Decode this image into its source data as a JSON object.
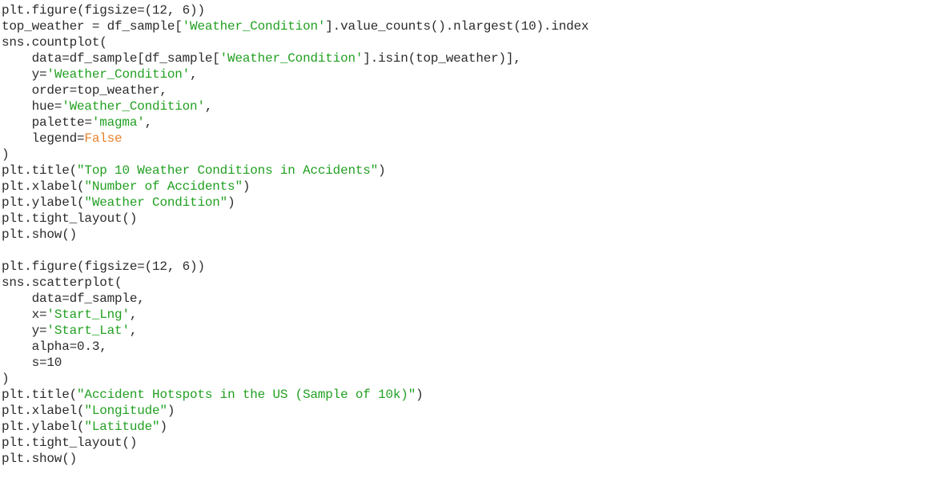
{
  "colors": {
    "background": "#ffffff",
    "default_text": "#2b2b2b",
    "string": "#22a022",
    "keyword": "#e8822a"
  },
  "code": {
    "lines": [
      [
        {
          "t": "plt.figure(figsize=(12, 6))",
          "k": "plain"
        }
      ],
      [
        {
          "t": "top_weather = df_sample[",
          "k": "plain"
        },
        {
          "t": "'Weather_Condition'",
          "k": "str"
        },
        {
          "t": "].value_counts().nlargest(10).index",
          "k": "plain"
        }
      ],
      [
        {
          "t": "sns.countplot(",
          "k": "plain"
        }
      ],
      [
        {
          "t": "    data=df_sample[df_sample[",
          "k": "plain"
        },
        {
          "t": "'Weather_Condition'",
          "k": "str"
        },
        {
          "t": "].isin(top_weather)],",
          "k": "plain"
        }
      ],
      [
        {
          "t": "    y=",
          "k": "plain"
        },
        {
          "t": "'Weather_Condition'",
          "k": "str"
        },
        {
          "t": ",",
          "k": "plain"
        }
      ],
      [
        {
          "t": "    order=top_weather,",
          "k": "plain"
        }
      ],
      [
        {
          "t": "    hue=",
          "k": "plain"
        },
        {
          "t": "'Weather_Condition'",
          "k": "str"
        },
        {
          "t": ",",
          "k": "plain"
        }
      ],
      [
        {
          "t": "    palette=",
          "k": "plain"
        },
        {
          "t": "'magma'",
          "k": "str"
        },
        {
          "t": ",",
          "k": "plain"
        }
      ],
      [
        {
          "t": "    legend=",
          "k": "plain"
        },
        {
          "t": "False",
          "k": "kw"
        }
      ],
      [
        {
          "t": ")",
          "k": "plain"
        }
      ],
      [
        {
          "t": "plt.title(",
          "k": "plain"
        },
        {
          "t": "\"Top 10 Weather Conditions in Accidents\"",
          "k": "str"
        },
        {
          "t": ")",
          "k": "plain"
        }
      ],
      [
        {
          "t": "plt.xlabel(",
          "k": "plain"
        },
        {
          "t": "\"Number of Accidents\"",
          "k": "str"
        },
        {
          "t": ")",
          "k": "plain"
        }
      ],
      [
        {
          "t": "plt.ylabel(",
          "k": "plain"
        },
        {
          "t": "\"Weather Condition\"",
          "k": "str"
        },
        {
          "t": ")",
          "k": "plain"
        }
      ],
      [
        {
          "t": "plt.tight_layout()",
          "k": "plain"
        }
      ],
      [
        {
          "t": "plt.show()",
          "k": "plain"
        }
      ],
      [
        {
          "t": "",
          "k": "plain"
        }
      ],
      [
        {
          "t": "plt.figure(figsize=(12, 6))",
          "k": "plain"
        }
      ],
      [
        {
          "t": "sns.scatterplot(",
          "k": "plain"
        }
      ],
      [
        {
          "t": "    data=df_sample,",
          "k": "plain"
        }
      ],
      [
        {
          "t": "    x=",
          "k": "plain"
        },
        {
          "t": "'Start_Lng'",
          "k": "str"
        },
        {
          "t": ",",
          "k": "plain"
        }
      ],
      [
        {
          "t": "    y=",
          "k": "plain"
        },
        {
          "t": "'Start_Lat'",
          "k": "str"
        },
        {
          "t": ",",
          "k": "plain"
        }
      ],
      [
        {
          "t": "    alpha=0.3,",
          "k": "plain"
        }
      ],
      [
        {
          "t": "    s=10",
          "k": "plain"
        }
      ],
      [
        {
          "t": ")",
          "k": "plain"
        }
      ],
      [
        {
          "t": "plt.title(",
          "k": "plain"
        },
        {
          "t": "\"Accident Hotspots in the US (Sample of 10k)\"",
          "k": "str"
        },
        {
          "t": ")",
          "k": "plain"
        }
      ],
      [
        {
          "t": "plt.xlabel(",
          "k": "plain"
        },
        {
          "t": "\"Longitude\"",
          "k": "str"
        },
        {
          "t": ")",
          "k": "plain"
        }
      ],
      [
        {
          "t": "plt.ylabel(",
          "k": "plain"
        },
        {
          "t": "\"Latitude\"",
          "k": "str"
        },
        {
          "t": ")",
          "k": "plain"
        }
      ],
      [
        {
          "t": "plt.tight_layout()",
          "k": "plain"
        }
      ],
      [
        {
          "t": "plt.show()",
          "k": "plain"
        }
      ]
    ]
  }
}
